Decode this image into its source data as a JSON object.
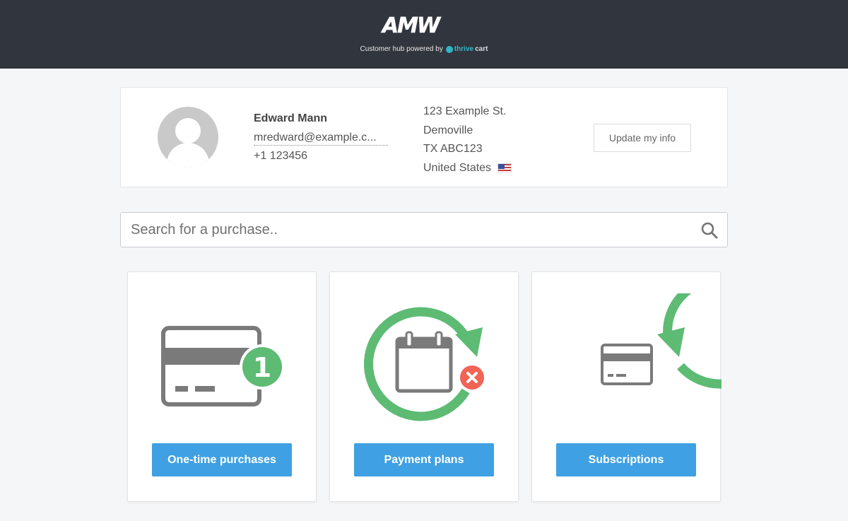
{
  "header": {
    "logo_text": "AMW",
    "powered_by": "Customer hub powered by",
    "brand_thrive": "thrive",
    "brand_cart": "cart"
  },
  "profile": {
    "name": "Edward Mann",
    "email": "mredward@example.c...",
    "phone": "+1 123456",
    "address_line1": "123 Example St.",
    "city": "Demoville",
    "region": "TX ABC123",
    "country": "United States",
    "update_label": "Update my info"
  },
  "search": {
    "placeholder": "Search for a purchase.."
  },
  "cards": [
    {
      "label": "One-time purchases",
      "badge": "1"
    },
    {
      "label": "Payment plans"
    },
    {
      "label": "Subscriptions"
    }
  ],
  "colors": {
    "header_bg": "#31353d",
    "accent_blue": "#3fa1e3",
    "cycle_green": "#5dbb73",
    "cancel_red": "#f06355",
    "icon_gray": "#7a7a7a"
  },
  "icons": [
    "search-icon",
    "user-avatar-icon",
    "us-flag-icon",
    "credit-card-icon",
    "calendar-icon",
    "refresh-cycle-icon",
    "cancel-icon"
  ]
}
